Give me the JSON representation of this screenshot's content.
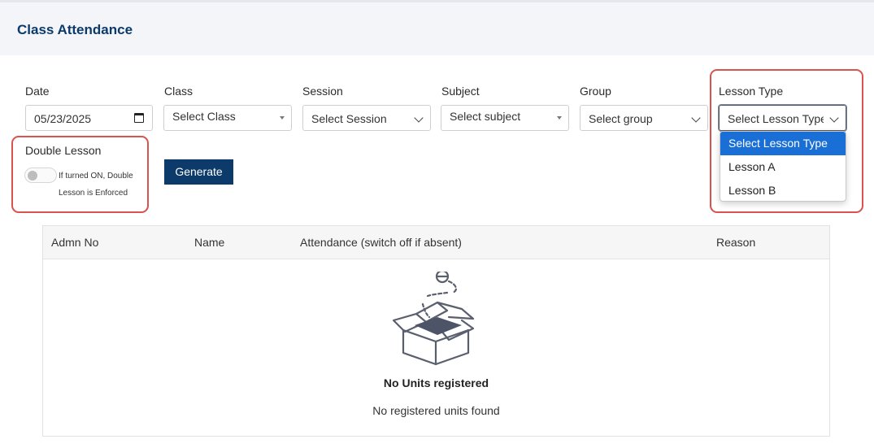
{
  "header": {
    "title": "Class Attendance"
  },
  "filters": {
    "date": {
      "label": "Date",
      "value": "05/23/2025"
    },
    "class": {
      "label": "Class",
      "placeholder": "Select Class"
    },
    "session": {
      "label": "Session",
      "placeholder": "Select Session"
    },
    "subject": {
      "label": "Subject",
      "placeholder": "Select subject"
    },
    "group": {
      "label": "Group",
      "placeholder": "Select group"
    },
    "lesson_type": {
      "label": "Lesson Type",
      "value": "Select Lesson Type",
      "options": [
        "Select Lesson Type",
        "Lesson A",
        "Lesson B"
      ]
    }
  },
  "double_lesson": {
    "label": "Double Lesson",
    "note": "If turned ON, Double Lesson is Enforced",
    "on": false
  },
  "generate_label": "Generate",
  "table": {
    "columns": [
      "Admn No",
      "Name",
      "Attendance (switch off if absent)",
      "Reason"
    ],
    "empty_title": "No Units registered",
    "empty_message": "No registered units found"
  },
  "colors": {
    "brand": "#0b3a6b",
    "highlight": "#d9534f",
    "selected": "#1a6fd6"
  },
  "icons": {
    "calendar": "calendar-icon",
    "empty": "empty-box-icon"
  }
}
